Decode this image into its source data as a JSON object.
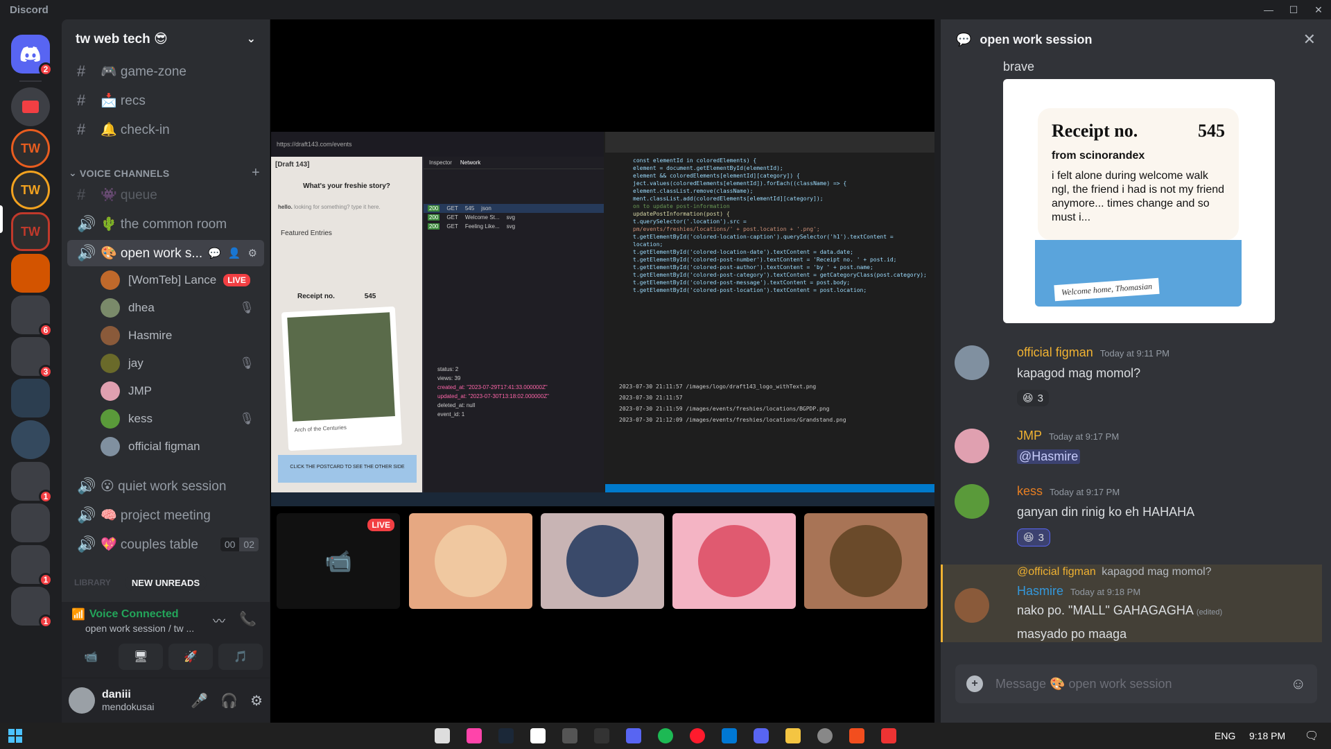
{
  "window": {
    "app_name": "Discord",
    "controls": [
      "—",
      "☐",
      "✕"
    ]
  },
  "server_rail": {
    "items": [
      {
        "name": "home",
        "badge": "2",
        "color": "#5865f2"
      },
      {
        "name": "server-folder",
        "badge": "",
        "color": "#f23f43"
      },
      {
        "name": "tw-server-1",
        "badge": "",
        "color": "#e85d1f"
      },
      {
        "name": "tw-server-2",
        "badge": "",
        "color": "#f2a21f"
      },
      {
        "name": "tw-web-tech",
        "badge": "",
        "color": "#c0392b"
      },
      {
        "name": "server-6",
        "badge": "",
        "color": "#d35400"
      },
      {
        "name": "server-7",
        "badge": "6",
        "color": "#3d3f45"
      },
      {
        "name": "server-8",
        "badge": "3",
        "color": "#3d3f45"
      },
      {
        "name": "server-9",
        "badge": "",
        "color": "#2c3e50"
      },
      {
        "name": "server-10",
        "badge": "",
        "color": "#34495e"
      },
      {
        "name": "server-11",
        "badge": "1",
        "color": "#3d3f45"
      },
      {
        "name": "server-12",
        "badge": "",
        "color": "#3d3f45"
      },
      {
        "name": "server-13",
        "badge": "1",
        "color": "#3d3f45"
      },
      {
        "name": "server-14",
        "badge": "1",
        "color": "#3d3f45"
      }
    ]
  },
  "sidebar": {
    "server_name": "tw web tech 😎",
    "text_channels": [
      {
        "label": "🎮 game-zone"
      },
      {
        "label": "📩 recs"
      },
      {
        "label": "🔔 check-in"
      }
    ],
    "voice_category": "VOICE CHANNELS",
    "voice_channels": [
      {
        "label": "👾 queue"
      },
      {
        "label": "🌵 the common room"
      },
      {
        "label": "🎨 open work s..."
      },
      {
        "label": "😮 quiet work session"
      },
      {
        "label": "🧠 project meeting"
      },
      {
        "label": "💖 couples table",
        "count_a": "00",
        "count_b": "02"
      }
    ],
    "voice_users": [
      {
        "name": "[WomTeb] Lance",
        "live": "LIVE",
        "color": "#c0692b"
      },
      {
        "name": "dhea",
        "live": "",
        "color": "#7a8a6a"
      },
      {
        "name": "Hasmire",
        "live": "",
        "color": "#8a5a3a"
      },
      {
        "name": "jay",
        "live": "",
        "color": "#6a6a2a"
      },
      {
        "name": "JMP",
        "live": "",
        "color": "#e0a0b0"
      },
      {
        "name": "kess",
        "live": "",
        "color": "#5a9a3a"
      },
      {
        "name": "official figman",
        "live": "",
        "color": "#8090a0"
      }
    ],
    "library_label": "LIBRARY",
    "new_unreads": "NEW UNREADS"
  },
  "voice_panel": {
    "status": "Voice Connected",
    "channel": "open work session / tw ..."
  },
  "user_panel": {
    "username": "daniii",
    "status": "mendokusai"
  },
  "stage": {
    "live_label": "LIVE",
    "tiles": [
      "Lance stream",
      "avatar-1",
      "avatar-2",
      "avatar-3",
      "avatar-4"
    ]
  },
  "shared_screen": {
    "browser_tab": "[Draft 143]",
    "url": "https://draft143.com/events",
    "page_heading": "What's your freshie story?",
    "hello": "hello.",
    "search_hint": "looking for something? type it here.",
    "featured": "Featured Entries",
    "receipt": "Receipt no.",
    "receipt_no": "545",
    "photo_caption": "Arch of the Centuries",
    "cta": "CLICK THE POSTCARD TO SEE THE OTHER SIDE",
    "devtools_tabs": [
      "Inspector",
      "Network"
    ],
    "network_rows": [
      {
        "status": "200",
        "method": "GET",
        "file": "545",
        "type": "json"
      },
      {
        "status": "200",
        "method": "GET",
        "file": "Welcome St...",
        "type": "svg"
      },
      {
        "status": "200",
        "method": "GET",
        "file": "Feeling Like...",
        "type": "svg"
      }
    ],
    "response_lines": [
      "status: 2",
      "views: 39",
      "created_at: \"2023-07-29T17:41:33.000000Z\"",
      "updated_at: \"2023-07-30T13:18:02.000000Z\"",
      "deleted_at: null",
      "event_id: 1"
    ],
    "code_lines": [
      "const elementId in coloredElements) {",
      "  element = document.getElementById(elementId);",
      "  element && coloredElements[elementId][category]) {",
      "  ject.values(coloredElements[elementId]).forEach((className) => {",
      "  element.classList.remove(className);",
      "",
      "  ment.classList.add(coloredElements[elementId][category]);",
      "",
      "  on to update post-information",
      "  updatePostInformation(post) {",
      "  t.querySelector('.location').src =",
      "  pm/events/freshies/locations/' + post.location + '.png';",
      "  t.getElementById('colored-location-caption').querySelector('h1').textContent =",
      "  location;",
      "  t.getElementById('colored-location-date').textContent = data.date;",
      "  t.getElementById('colored-post-number').textContent = 'Receipt no. ' + post.id;",
      "  t.getElementById('colored-post-author').textContent = 'by ' + post.name;",
      "  t.getElementById('colored-post-category').textContent = getCategoryClass(post.category);",
      "  t.getElementById('colored-post-message').textContent = post.body;",
      "  t.getElementById('colored-post-location').textContent = post.location;"
    ],
    "terminal_lines": [
      "2023-07-30 21:11:57 /images/logo/draft143_logo_withText.png",
      "2023-07-30 21:11:57",
      "2023-07-30 21:11:59 /images/events/freshies/locations/BGPDP.png",
      "2023-07-30 21:12:09 /images/events/freshies/locations/Grandstand.png"
    ]
  },
  "chat": {
    "title": "open work session",
    "top_text": "brave",
    "embed": {
      "receipt_label": "Receipt no.",
      "receipt_no": "545",
      "from": "from scinorandex",
      "body": "i felt alone during welcome walk ngl, the friend i had is not my friend anymore... times change and so must i...",
      "envelope_note": "Welcome home, Thomasian"
    },
    "messages": [
      {
        "author": "official figman",
        "color": "#f0b232",
        "time": "Today at 9:11 PM",
        "text": "kapagod mag momol?",
        "reaction": "😆",
        "count": "3",
        "av": "#8090a0"
      },
      {
        "author": "JMP",
        "color": "#f0b232",
        "time": "Today at 9:17 PM",
        "text": "@Hasmire",
        "reaction": "",
        "count": "",
        "av": "#e0a0b0"
      },
      {
        "author": "kess",
        "color": "#e67e22",
        "time": "Today at 9:17 PM",
        "text": "ganyan din rinig ko eh HAHAHA",
        "reaction": "😆",
        "count": "3",
        "av": "#5a9a3a"
      },
      {
        "author": "Hasmire",
        "color": "#3498db",
        "time": "Today at 9:18 PM",
        "text": "nako po. \"MALL\" GAHAGAGHA",
        "edited": "(edited)",
        "reply_to": "@official figman",
        "reply_text": "kapagod mag momol?",
        "av": "#8a5a3a"
      }
    ],
    "follow_up": "masyado po maaga",
    "input_placeholder": "Message 🎨 open work session"
  },
  "taskbar": {
    "lang": "ENG",
    "time": "9:18 PM"
  }
}
